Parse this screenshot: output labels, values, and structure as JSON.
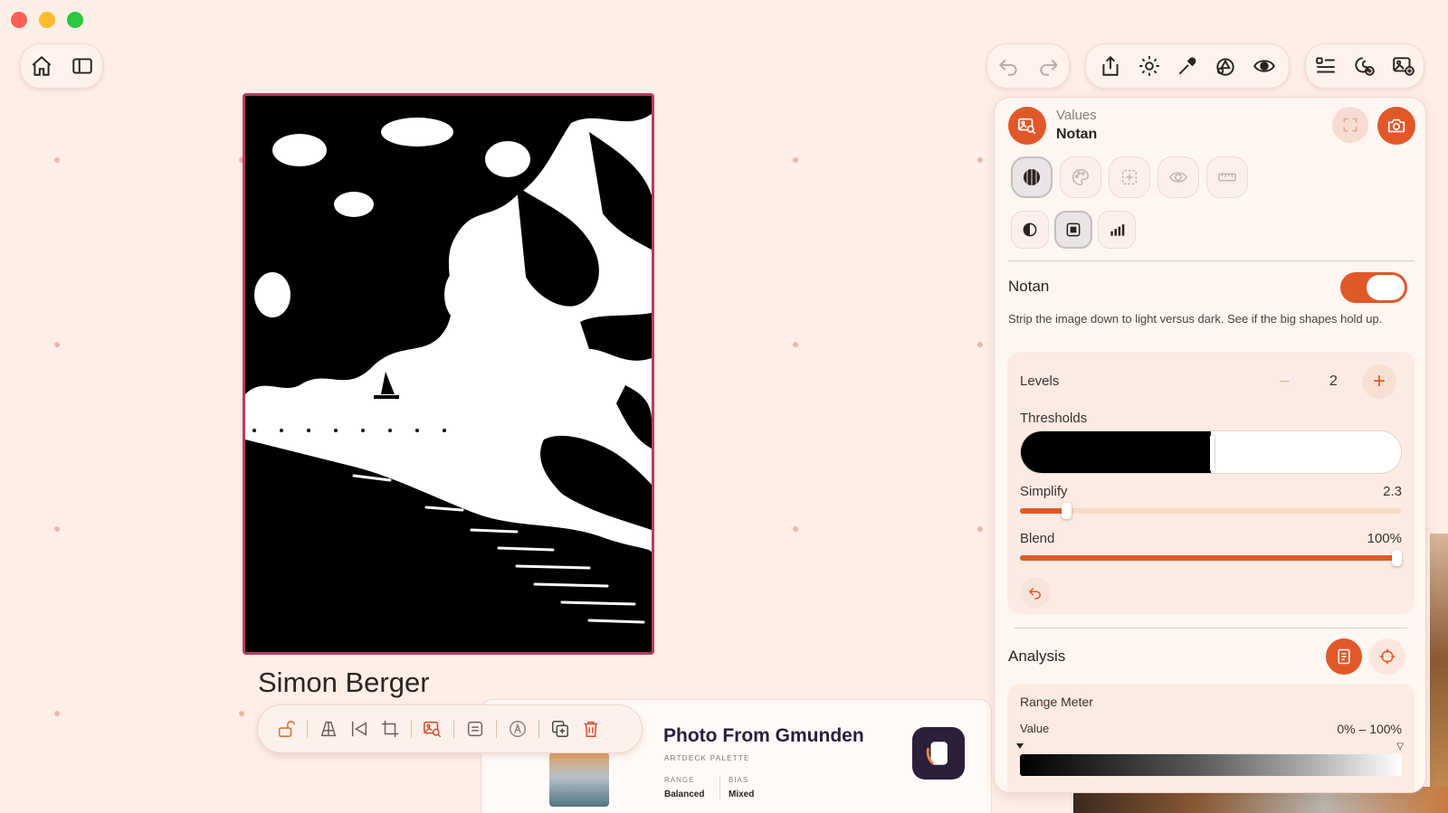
{
  "window": {
    "traffic_lights": [
      "close",
      "minimize",
      "zoom"
    ]
  },
  "left_toolbar": {
    "icons": [
      "home-icon",
      "sidebar-icon"
    ]
  },
  "top_toolbar": {
    "history_icons": [
      "undo-icon",
      "redo-icon"
    ],
    "action_icons": [
      "share-icon",
      "settings-icon",
      "eyedropper-icon",
      "shapes-icon",
      "eye-icon"
    ],
    "right_icons": [
      "list-icon",
      "palette-add-icon",
      "image-add-icon"
    ]
  },
  "canvas": {
    "artist_name": "Simon Berger",
    "border_color": "#b83b5e"
  },
  "palette_card": {
    "title": "Photo From Gmunden",
    "subtitle": "ARTDECK PALETTE",
    "range_key": "RANGE",
    "range_value": "Balanced",
    "bias_key": "BIAS",
    "bias_value": "Mixed"
  },
  "bottom_toolbar": {
    "icons": [
      "unlock-icon",
      "perspective-icon",
      "flip-icon",
      "crop-icon",
      "image-search-icon",
      "adjust-icon",
      "auto-icon",
      "duplicate-icon",
      "trash-icon"
    ]
  },
  "panel": {
    "header_category": "Values",
    "header_title": "Notan",
    "mode_tabs": [
      "sphere-icon",
      "palette-icon",
      "grid-icon",
      "eye-icon",
      "ruler-icon"
    ],
    "sub_tabs": [
      "contrast-icon",
      "square-icon",
      "bars-icon"
    ],
    "notan": {
      "title": "Notan",
      "enabled": true,
      "description": "Strip the image down to light versus dark. See if the big shapes hold up."
    },
    "levels": {
      "label": "Levels",
      "minus": "−",
      "value": "2",
      "plus": "+"
    },
    "thresholds": {
      "label": "Thresholds",
      "split": 0.5
    },
    "simplify": {
      "label": "Simplify",
      "value_text": "2.3",
      "fraction": 0.12
    },
    "blend": {
      "label": "Blend",
      "value_text": "100%",
      "fraction": 1.0
    },
    "analysis": {
      "title": "Analysis"
    },
    "range_meter": {
      "title": "Range Meter",
      "value_label": "Value",
      "value_range": "0% – 100%"
    }
  },
  "colors": {
    "accent": "#e0582a",
    "background": "#fdeee7"
  }
}
